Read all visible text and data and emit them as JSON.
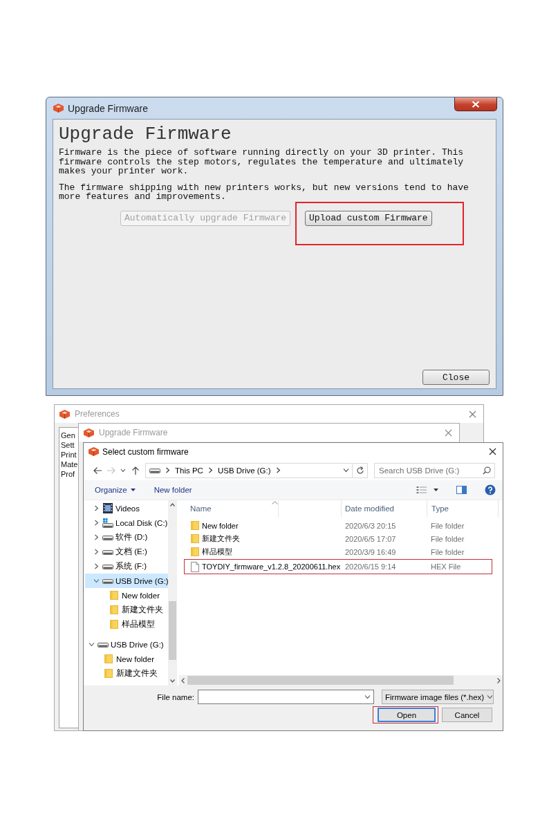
{
  "upgrade_dialog": {
    "title": "Upgrade Firmware",
    "heading": "Upgrade Firmware",
    "paragraphs": [
      "Firmware is the piece of software running directly on your 3D printer. This firmware controls the step motors, regulates the temperature and ultimately makes your printer work.",
      "The firmware shipping with new printers works, but new versions tend to have more features and improvements."
    ],
    "buttons": [
      {
        "label": "Automatically upgrade Firmware",
        "disabled": true,
        "highlighted": false
      },
      {
        "label": "Upload custom Firmware",
        "disabled": false,
        "highlighted": true
      }
    ],
    "close_button": "Close"
  },
  "preferences_window": {
    "title": "Preferences",
    "list_items": [
      "Gen",
      "Sett",
      "Print",
      "Mate",
      "Prof"
    ]
  },
  "background_dialog": {
    "title": "Upgrade Firmware"
  },
  "file_dialog": {
    "title": "Select custom firmware",
    "nav_buttons": [
      {
        "kind": "back",
        "disabled": false
      },
      {
        "kind": "forward",
        "disabled": true
      },
      {
        "kind": "recent",
        "disabled": false
      },
      {
        "kind": "up",
        "disabled": false
      }
    ],
    "breadcrumb": [
      "This PC",
      "USB Drive (G:)"
    ],
    "search": {
      "placeholder": "Search USB Drive (G:)"
    },
    "organize_menu": "Organize",
    "new_folder_button": "New folder",
    "this_pc_items": [
      {
        "label": "Videos",
        "kind": "videos",
        "expanded": false,
        "selected": false
      },
      {
        "label": "Local Disk (C:)",
        "kind": "system-drive",
        "expanded": false,
        "selected": false
      },
      {
        "label": "软件 (D:)",
        "kind": "drive",
        "expanded": false,
        "selected": false
      },
      {
        "label": "文档 (E:)",
        "kind": "drive",
        "expanded": false,
        "selected": false
      },
      {
        "label": "系统 (F:)",
        "kind": "drive",
        "expanded": false,
        "selected": false
      },
      {
        "label": "USB Drive (G:)",
        "kind": "drive",
        "expanded": true,
        "selected": true,
        "children": [
          {
            "label": "New folder",
            "kind": "folder",
            "selected": false
          },
          {
            "label": "新建文件夹",
            "kind": "folder",
            "selected": false
          },
          {
            "label": "样品模型",
            "kind": "folder",
            "selected": false
          }
        ]
      }
    ],
    "root_items": [
      {
        "label": "USB Drive (G:)",
        "kind": "drive",
        "expanded": true,
        "selected": false,
        "children": [
          {
            "label": "New folder",
            "kind": "folder",
            "selected": false
          },
          {
            "label": "新建文件夹",
            "kind": "folder",
            "selected": false
          }
        ]
      }
    ],
    "columns": [
      "Name",
      "Date modified",
      "Type"
    ],
    "files": [
      {
        "name": "New folder",
        "date": "2020/6/3 20:15",
        "type": "File folder",
        "kind": "folder",
        "highlighted": false
      },
      {
        "name": "新建文件夹",
        "date": "2020/6/5 17:07",
        "type": "File folder",
        "kind": "folder",
        "highlighted": false
      },
      {
        "name": "样品模型",
        "date": "2020/3/9 16:49",
        "type": "File folder",
        "kind": "folder",
        "highlighted": false
      },
      {
        "name": "TOYDIY_firmware_v1.2.8_20200611.hex",
        "date": "2020/6/15 9:14",
        "type": "HEX File",
        "kind": "file",
        "highlighted": true
      }
    ],
    "file_name_label": "File name:",
    "file_type": "Firmware image files (*.hex)",
    "buttons": [
      {
        "label": "Open",
        "default": true,
        "highlighted": true
      },
      {
        "label": "Cancel",
        "default": false,
        "highlighted": false
      }
    ]
  }
}
